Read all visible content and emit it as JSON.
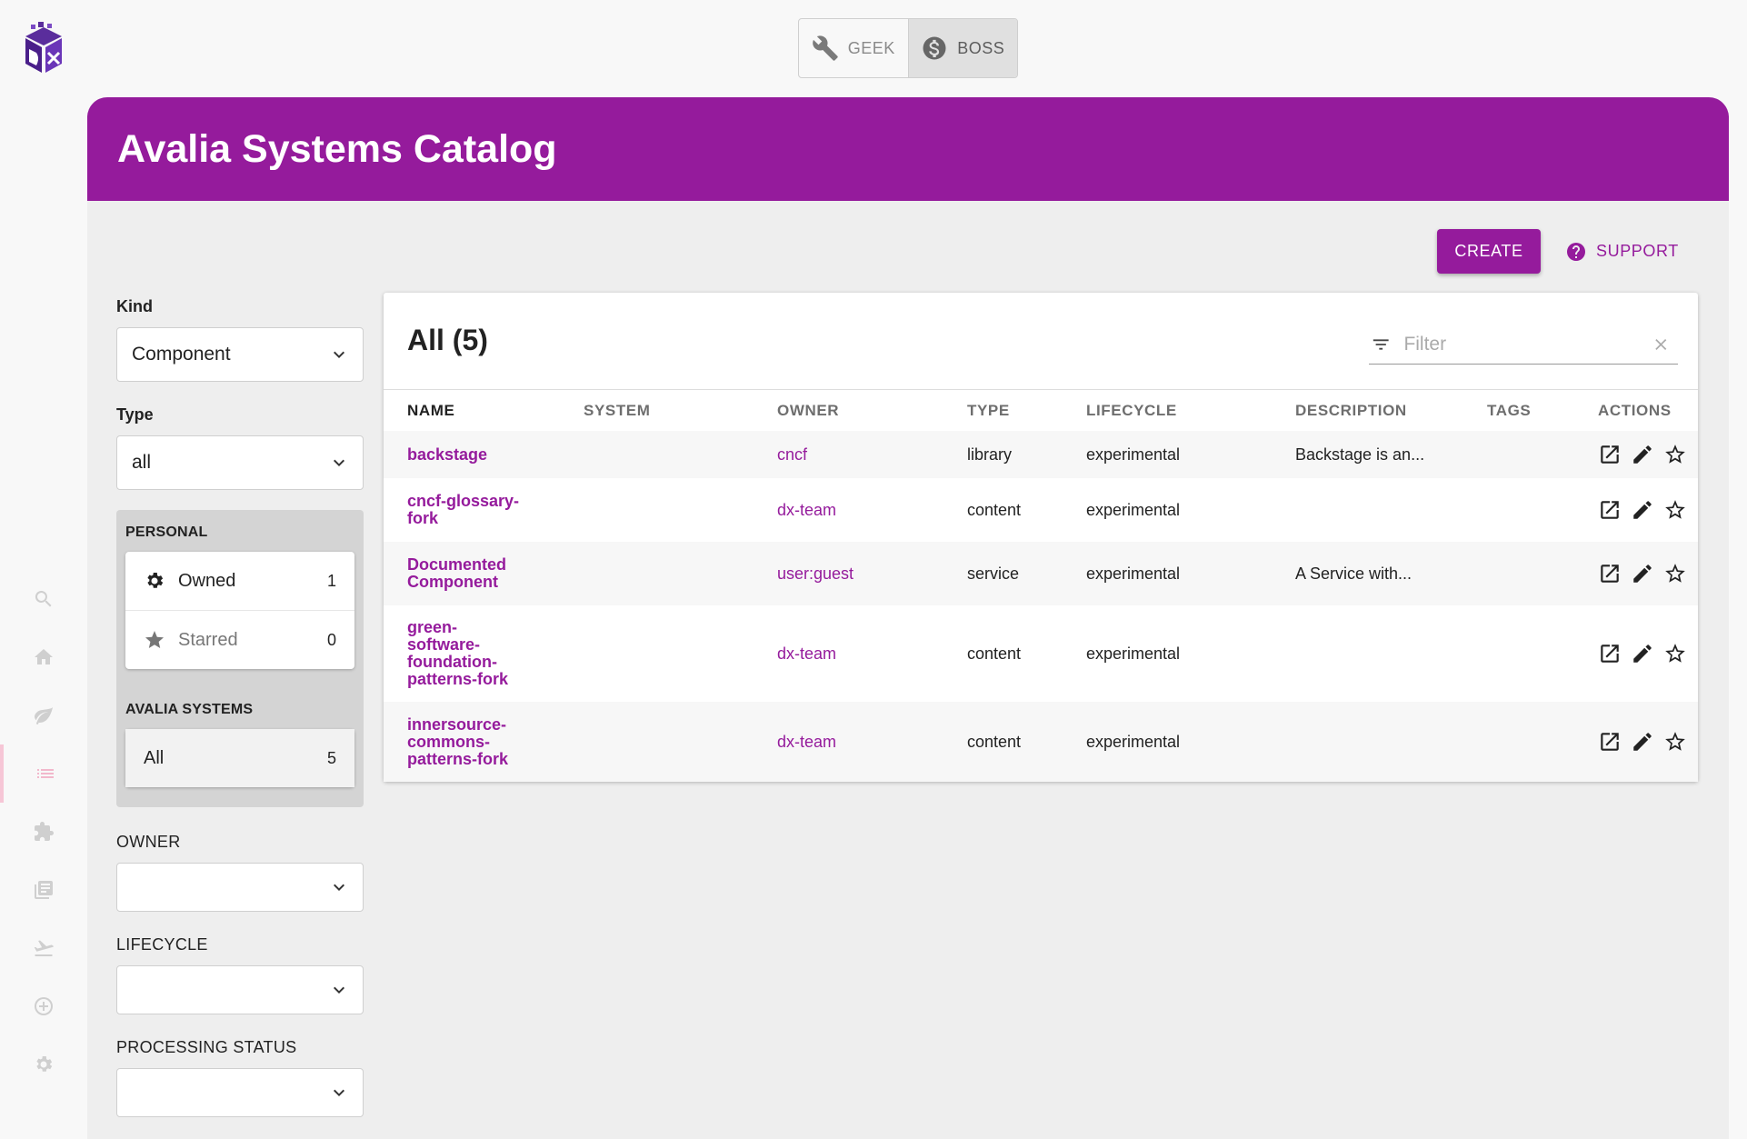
{
  "app": {
    "title": "Avalia Systems Catalog"
  },
  "mode_toggle": {
    "geek_label": "GEEK",
    "boss_label": "BOSS",
    "selected": "BOSS"
  },
  "nav": {
    "items": [
      "search-icon",
      "home-icon",
      "leaf-icon",
      "catalog-list-icon",
      "plugin-icon",
      "docs-icon",
      "deploy-icon",
      "create-icon",
      "settings-icon"
    ],
    "active": "catalog-list-icon"
  },
  "toolbar": {
    "create_label": "CREATE",
    "support_label": "SUPPORT"
  },
  "filters": {
    "kind_label": "Kind",
    "kind_value": "Component",
    "type_label": "Type",
    "type_value": "all",
    "personal_title": "PERSONAL",
    "owned_label": "Owned",
    "owned_count": "1",
    "starred_label": "Starred",
    "starred_count": "0",
    "org_title": "AVALIA SYSTEMS",
    "all_label": "All",
    "all_count": "5",
    "owner_label": "OWNER",
    "lifecycle_label": "LIFECYCLE",
    "processing_label": "PROCESSING STATUS"
  },
  "table": {
    "title": "All (5)",
    "filter_placeholder": "Filter",
    "columns": [
      "NAME",
      "SYSTEM",
      "OWNER",
      "TYPE",
      "LIFECYCLE",
      "DESCRIPTION",
      "TAGS",
      "ACTIONS"
    ],
    "rows": [
      {
        "name": "backstage",
        "system": "",
        "owner": "cncf",
        "type": "library",
        "lifecycle": "experimental",
        "description": "Backstage is an..."
      },
      {
        "name": "cncf-glossary-fork",
        "system": "",
        "owner": "dx-team",
        "type": "content",
        "lifecycle": "experimental",
        "description": ""
      },
      {
        "name": "Documented Component",
        "system": "",
        "owner": "user:guest",
        "type": "service",
        "lifecycle": "experimental",
        "description": "A Service with..."
      },
      {
        "name": "green-software-foundation-patterns-fork",
        "system": "",
        "owner": "dx-team",
        "type": "content",
        "lifecycle": "experimental",
        "description": ""
      },
      {
        "name": "innersource-commons-patterns-fork",
        "system": "",
        "owner": "dx-team",
        "type": "content",
        "lifecycle": "experimental",
        "description": ""
      }
    ]
  },
  "colors": {
    "brand": "#951b9c",
    "background": "#eeeeee"
  }
}
